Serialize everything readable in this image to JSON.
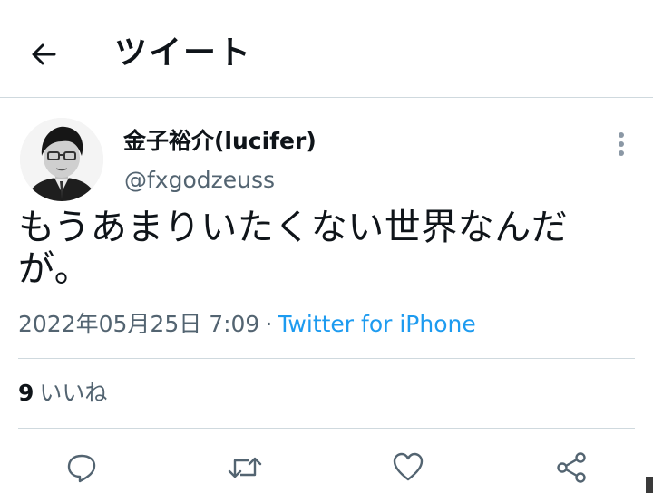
{
  "header": {
    "title": "ツイート",
    "back_icon": "arrow-left-icon"
  },
  "tweet": {
    "author": {
      "display_name": "金子裕介(lucifer)",
      "handle": "@fxgodzeuss",
      "avatar": "avatar-photo"
    },
    "more_icon": "more-vertical-icon",
    "text": "もうあまりいたくない世界なんだが。",
    "timestamp": "2022年05月25日 7:09",
    "separator": "·",
    "source": "Twitter for iPhone",
    "likes_count": "9",
    "likes_label": "いいね"
  },
  "actions": [
    {
      "name": "reply",
      "icon": "reply-icon"
    },
    {
      "name": "retweet",
      "icon": "retweet-icon"
    },
    {
      "name": "like",
      "icon": "heart-icon"
    },
    {
      "name": "share",
      "icon": "share-icon"
    }
  ],
  "colors": {
    "text_primary": "#0f1419",
    "text_secondary": "#536471",
    "link": "#1d9bf0",
    "divider": "#cfd9de"
  }
}
